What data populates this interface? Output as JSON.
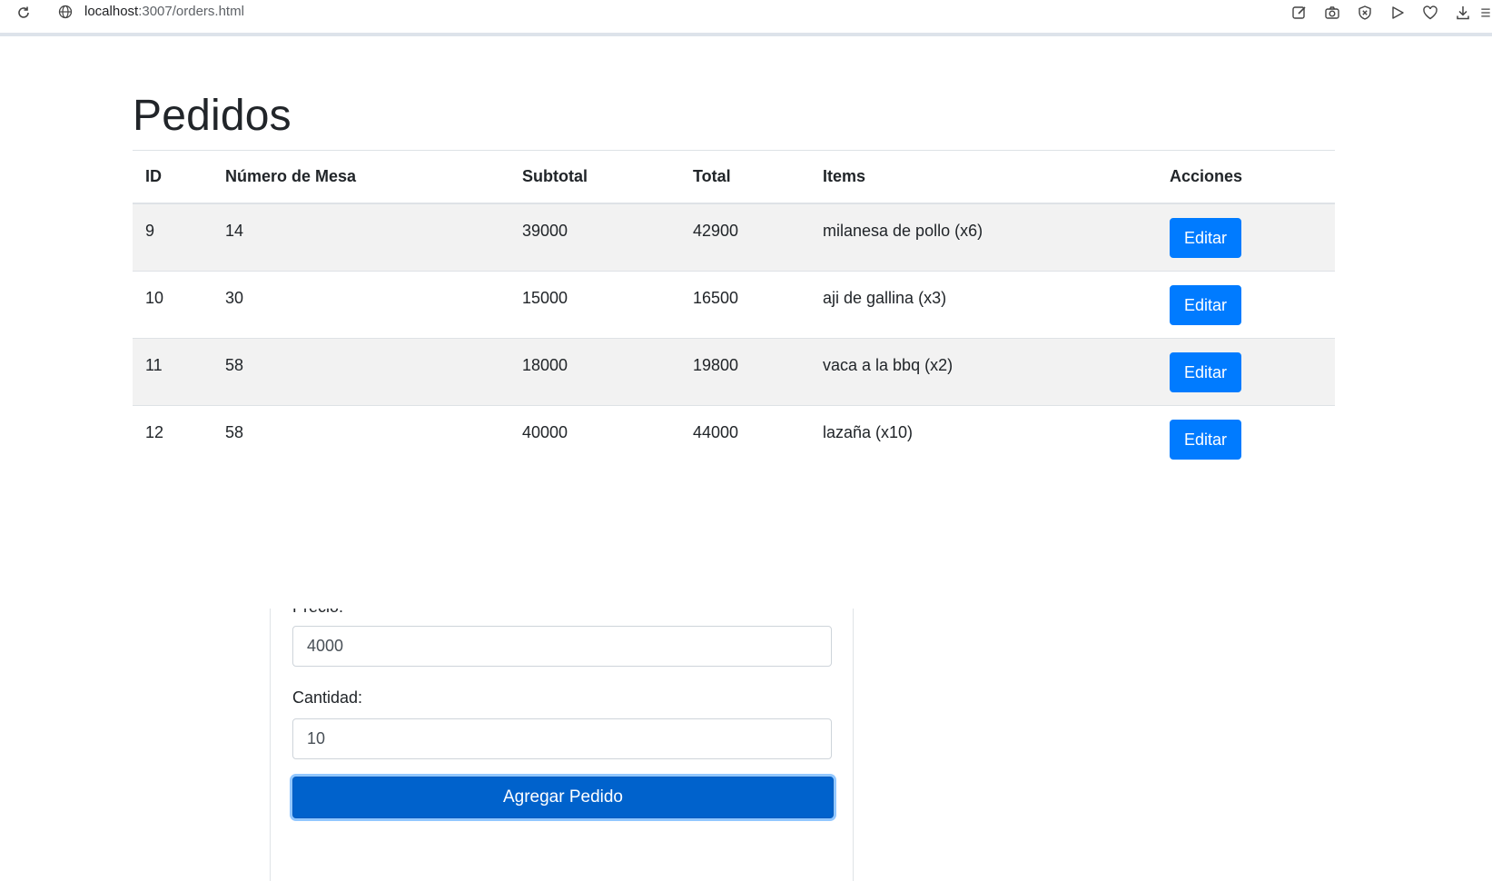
{
  "browser": {
    "url_host": "localhost",
    "url_rest": ":3007/orders.html",
    "icons": [
      "reload-icon",
      "globe-icon",
      "edit-note-icon",
      "camera-icon",
      "shield-x-icon",
      "play-icon",
      "heart-icon",
      "download-icon",
      "menu-icon"
    ]
  },
  "page": {
    "title": "Pedidos"
  },
  "table": {
    "headers": {
      "id": "ID",
      "mesa": "Número de Mesa",
      "subtotal": "Subtotal",
      "total": "Total",
      "items": "Items",
      "acciones": "Acciones"
    },
    "rows": [
      {
        "id": "9",
        "mesa": "14",
        "subtotal": "39000",
        "total": "42900",
        "items": "milanesa de pollo (x6)",
        "action": "Editar"
      },
      {
        "id": "10",
        "mesa": "30",
        "subtotal": "15000",
        "total": "16500",
        "items": "aji de gallina (x3)",
        "action": "Editar"
      },
      {
        "id": "11",
        "mesa": "58",
        "subtotal": "18000",
        "total": "19800",
        "items": "vaca a la bbq (x2)",
        "action": "Editar"
      },
      {
        "id": "12",
        "mesa": "58",
        "subtotal": "40000",
        "total": "44000",
        "items": "lazaña (x10)",
        "action": "Editar"
      }
    ]
  },
  "form": {
    "precio_label": "Precio:",
    "precio_value": "4000",
    "cantidad_label": "Cantidad:",
    "cantidad_value": "10",
    "submit_label": "Agregar Pedido"
  },
  "colors": {
    "primary": "#007bff",
    "primary_active": "#0062cc",
    "stripe": "#f2f2f2"
  }
}
